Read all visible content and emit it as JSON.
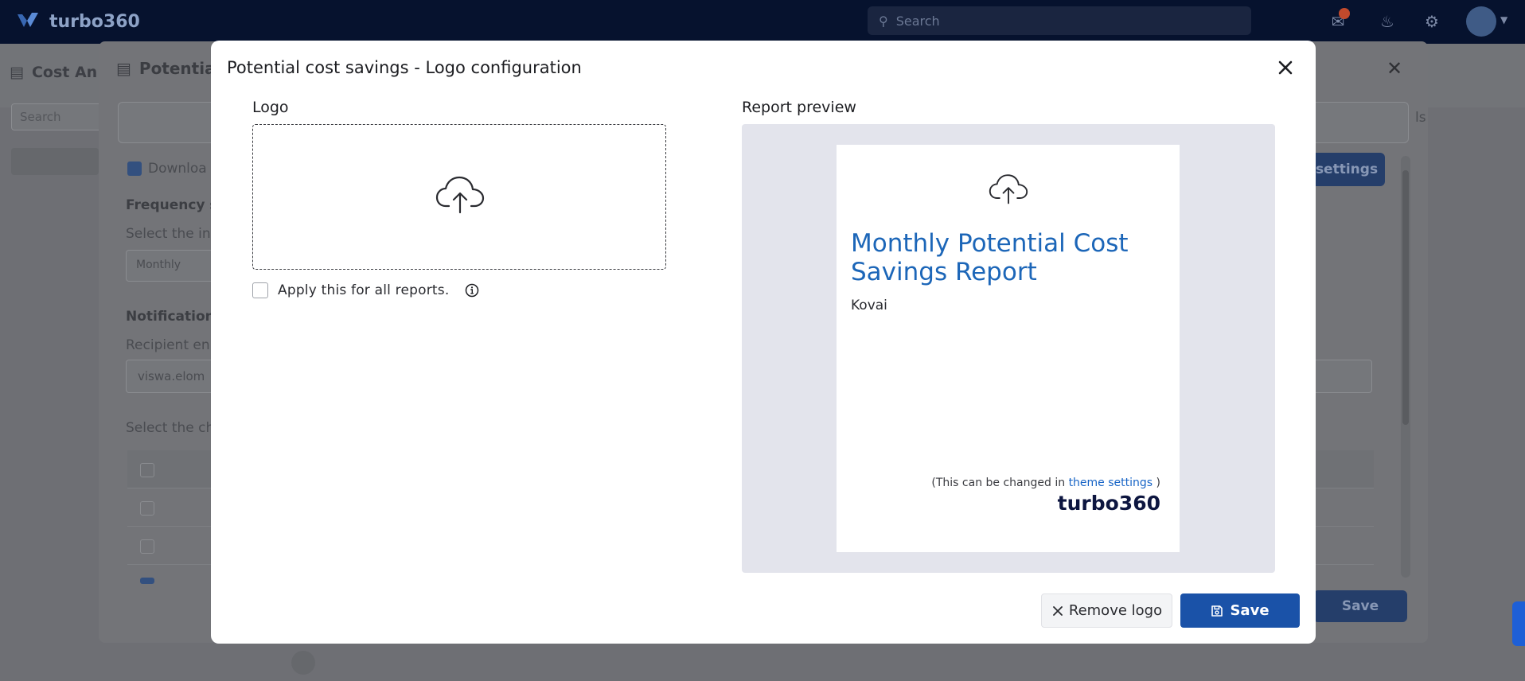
{
  "app": {
    "brand": "turbo360",
    "search_placeholder": "Search"
  },
  "background": {
    "page_title": "Cost An",
    "search_placeholder": "Search",
    "panel_title": "Potentia",
    "download_label": "Downloa",
    "frequency_heading": "Frequency s",
    "select_interval": "Select the in",
    "monthly_value": "Monthly",
    "notification_heading": "Notification",
    "recipient_label": "Recipient en",
    "recipient_value": "viswa.elom",
    "select_channel": "Select the ch",
    "settings_button": "settings",
    "save_button": "Save",
    "right_text_1": "ls"
  },
  "modal": {
    "title": "Potential cost savings - Logo configuration",
    "logo_label": "Logo",
    "apply_label": "Apply this for all reports.",
    "apply_checked": false,
    "preview_label": "Report preview",
    "preview": {
      "heading": "Monthly Potential Cost Savings Report",
      "organization": "Kovai",
      "note_prefix": "(This can be changed in ",
      "note_link": "theme settings",
      "note_suffix": " )",
      "brand": "turbo360"
    },
    "buttons": {
      "remove_logo": "Remove logo",
      "save": "Save"
    },
    "colors": {
      "primary": "#1a52a8",
      "heading": "#1c66b8",
      "preview_bg": "#e3e4ec"
    }
  }
}
